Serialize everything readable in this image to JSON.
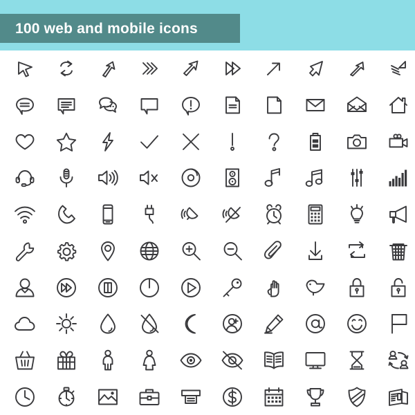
{
  "header": {
    "title": "100 web and mobile icons",
    "band_color": "#8ddde6",
    "bar_color": "#528a8a",
    "title_color": "#ffffff"
  },
  "grid": {
    "columns": 10,
    "rows": 10,
    "icon_count": 100,
    "stroke_color": "#3a3a3d",
    "background_color": "#ffffff"
  },
  "icons": [
    {
      "row": 1,
      "col": 1,
      "name": "cursor-arrow-icon"
    },
    {
      "row": 1,
      "col": 2,
      "name": "refresh-sync-arrows-icon"
    },
    {
      "row": 1,
      "col": 3,
      "name": "arrow-up-right-icon"
    },
    {
      "row": 1,
      "col": 4,
      "name": "double-chevron-right-icon"
    },
    {
      "row": 1,
      "col": 5,
      "name": "arrow-up-right-bold-icon"
    },
    {
      "row": 1,
      "col": 6,
      "name": "fast-forward-icon"
    },
    {
      "row": 1,
      "col": 7,
      "name": "arrow-up-right-thin-icon"
    },
    {
      "row": 1,
      "col": 8,
      "name": "cursor-pointer-icon"
    },
    {
      "row": 1,
      "col": 9,
      "name": "arrow-up-right-outline-icon"
    },
    {
      "row": 1,
      "col": 10,
      "name": "arrow-motion-lines-icon"
    },
    {
      "row": 2,
      "col": 1,
      "name": "chat-bubble-round-icon"
    },
    {
      "row": 2,
      "col": 2,
      "name": "chat-bubble-square-icon"
    },
    {
      "row": 2,
      "col": 3,
      "name": "chat-bubbles-dots-icon"
    },
    {
      "row": 2,
      "col": 4,
      "name": "speech-bubble-empty-icon"
    },
    {
      "row": 2,
      "col": 5,
      "name": "alert-bubble-icon"
    },
    {
      "row": 2,
      "col": 6,
      "name": "document-lines-icon"
    },
    {
      "row": 2,
      "col": 7,
      "name": "document-blank-icon"
    },
    {
      "row": 2,
      "col": 8,
      "name": "envelope-closed-icon"
    },
    {
      "row": 2,
      "col": 9,
      "name": "envelope-open-icon"
    },
    {
      "row": 2,
      "col": 10,
      "name": "house-icon"
    },
    {
      "row": 3,
      "col": 1,
      "name": "heart-icon"
    },
    {
      "row": 3,
      "col": 2,
      "name": "star-icon"
    },
    {
      "row": 3,
      "col": 3,
      "name": "lightning-bolt-icon"
    },
    {
      "row": 3,
      "col": 4,
      "name": "checkmark-icon"
    },
    {
      "row": 3,
      "col": 5,
      "name": "close-cross-icon"
    },
    {
      "row": 3,
      "col": 6,
      "name": "exclamation-mark-icon"
    },
    {
      "row": 3,
      "col": 7,
      "name": "question-mark-icon"
    },
    {
      "row": 3,
      "col": 8,
      "name": "battery-icon"
    },
    {
      "row": 3,
      "col": 9,
      "name": "camera-icon"
    },
    {
      "row": 3,
      "col": 10,
      "name": "video-camera-icon"
    },
    {
      "row": 4,
      "col": 1,
      "name": "headset-icon"
    },
    {
      "row": 4,
      "col": 2,
      "name": "microphone-icon"
    },
    {
      "row": 4,
      "col": 3,
      "name": "speaker-volume-icon"
    },
    {
      "row": 4,
      "col": 4,
      "name": "speaker-muted-icon"
    },
    {
      "row": 4,
      "col": 5,
      "name": "compact-disc-icon"
    },
    {
      "row": 4,
      "col": 6,
      "name": "speaker-cabinet-icon"
    },
    {
      "row": 4,
      "col": 7,
      "name": "music-note-icon"
    },
    {
      "row": 4,
      "col": 8,
      "name": "double-music-note-icon"
    },
    {
      "row": 4,
      "col": 9,
      "name": "equalizer-sliders-icon"
    },
    {
      "row": 4,
      "col": 10,
      "name": "signal-bars-icon"
    },
    {
      "row": 5,
      "col": 1,
      "name": "wifi-icon"
    },
    {
      "row": 5,
      "col": 2,
      "name": "phone-handset-icon"
    },
    {
      "row": 5,
      "col": 3,
      "name": "smartphone-icon"
    },
    {
      "row": 5,
      "col": 4,
      "name": "power-plug-icon"
    },
    {
      "row": 5,
      "col": 5,
      "name": "bell-ringing-icon"
    },
    {
      "row": 5,
      "col": 6,
      "name": "bell-muted-icon"
    },
    {
      "row": 5,
      "col": 7,
      "name": "alarm-clock-icon"
    },
    {
      "row": 5,
      "col": 8,
      "name": "calculator-icon"
    },
    {
      "row": 5,
      "col": 9,
      "name": "light-bulb-icon"
    },
    {
      "row": 5,
      "col": 10,
      "name": "megaphone-icon"
    },
    {
      "row": 6,
      "col": 1,
      "name": "wrench-icon"
    },
    {
      "row": 6,
      "col": 2,
      "name": "gear-icon"
    },
    {
      "row": 6,
      "col": 3,
      "name": "map-pin-icon"
    },
    {
      "row": 6,
      "col": 4,
      "name": "globe-icon"
    },
    {
      "row": 6,
      "col": 5,
      "name": "zoom-in-icon"
    },
    {
      "row": 6,
      "col": 6,
      "name": "zoom-out-icon"
    },
    {
      "row": 6,
      "col": 7,
      "name": "paperclip-icon"
    },
    {
      "row": 6,
      "col": 8,
      "name": "download-icon"
    },
    {
      "row": 6,
      "col": 9,
      "name": "loop-repeat-icon"
    },
    {
      "row": 6,
      "col": 10,
      "name": "trash-can-icon"
    },
    {
      "row": 7,
      "col": 1,
      "name": "user-avatar-icon"
    },
    {
      "row": 7,
      "col": 2,
      "name": "fast-forward-circle-icon"
    },
    {
      "row": 7,
      "col": 3,
      "name": "pause-circle-icon"
    },
    {
      "row": 7,
      "col": 4,
      "name": "power-button-icon"
    },
    {
      "row": 7,
      "col": 5,
      "name": "play-circle-icon"
    },
    {
      "row": 7,
      "col": 6,
      "name": "key-icon"
    },
    {
      "row": 7,
      "col": 7,
      "name": "pointing-hand-icon"
    },
    {
      "row": 7,
      "col": 8,
      "name": "bird-icon"
    },
    {
      "row": 7,
      "col": 9,
      "name": "lock-closed-icon"
    },
    {
      "row": 7,
      "col": 10,
      "name": "lock-open-icon"
    },
    {
      "row": 8,
      "col": 1,
      "name": "cloud-icon"
    },
    {
      "row": 8,
      "col": 2,
      "name": "sun-icon"
    },
    {
      "row": 8,
      "col": 3,
      "name": "water-drop-icon"
    },
    {
      "row": 8,
      "col": 4,
      "name": "no-water-drop-icon"
    },
    {
      "row": 8,
      "col": 5,
      "name": "moon-icon"
    },
    {
      "row": 8,
      "col": 6,
      "name": "add-user-circle-icon"
    },
    {
      "row": 8,
      "col": 7,
      "name": "pencil-edit-icon"
    },
    {
      "row": 8,
      "col": 8,
      "name": "at-sign-icon"
    },
    {
      "row": 8,
      "col": 9,
      "name": "smiley-face-icon"
    },
    {
      "row": 8,
      "col": 10,
      "name": "flag-icon"
    },
    {
      "row": 9,
      "col": 1,
      "name": "shopping-basket-icon"
    },
    {
      "row": 9,
      "col": 2,
      "name": "gift-box-icon"
    },
    {
      "row": 9,
      "col": 3,
      "name": "man-figure-icon"
    },
    {
      "row": 9,
      "col": 4,
      "name": "woman-figure-icon"
    },
    {
      "row": 9,
      "col": 5,
      "name": "eye-icon"
    },
    {
      "row": 9,
      "col": 6,
      "name": "eye-hidden-icon"
    },
    {
      "row": 9,
      "col": 7,
      "name": "open-book-icon"
    },
    {
      "row": 9,
      "col": 8,
      "name": "monitor-icon"
    },
    {
      "row": 9,
      "col": 9,
      "name": "hourglass-icon"
    },
    {
      "row": 9,
      "col": 10,
      "name": "user-exchange-icon"
    },
    {
      "row": 10,
      "col": 1,
      "name": "clock-icon"
    },
    {
      "row": 10,
      "col": 2,
      "name": "stopwatch-icon"
    },
    {
      "row": 10,
      "col": 3,
      "name": "image-photo-icon"
    },
    {
      "row": 10,
      "col": 4,
      "name": "briefcase-icon"
    },
    {
      "row": 10,
      "col": 5,
      "name": "atm-printer-icon"
    },
    {
      "row": 10,
      "col": 6,
      "name": "dollar-circle-icon"
    },
    {
      "row": 10,
      "col": 7,
      "name": "calendar-icon"
    },
    {
      "row": 10,
      "col": 8,
      "name": "trophy-icon"
    },
    {
      "row": 10,
      "col": 9,
      "name": "shield-icon"
    },
    {
      "row": 10,
      "col": 10,
      "name": "newspaper-icon"
    }
  ]
}
